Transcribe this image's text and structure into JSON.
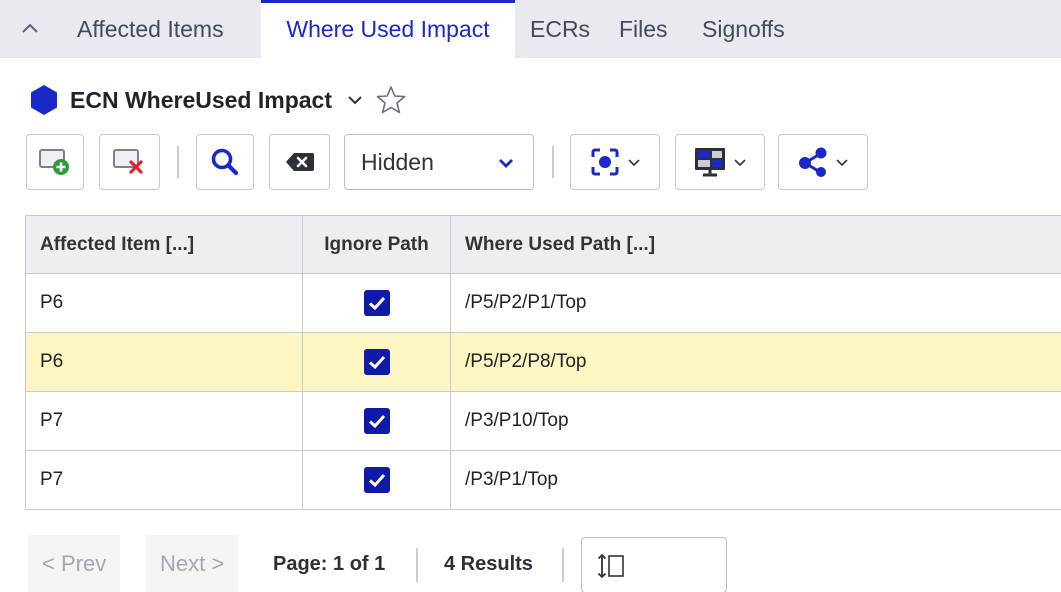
{
  "tabs": [
    {
      "label": "Affected Items",
      "active": false
    },
    {
      "label": "Where Used Impact",
      "active": true
    },
    {
      "label": "ECRs",
      "active": false
    },
    {
      "label": "Files",
      "active": false
    },
    {
      "label": "Signoffs",
      "active": false
    }
  ],
  "header": {
    "title": "ECN WhereUsed Impact",
    "icon": "hexagon-icon",
    "favorite_icon": "star-outline-icon"
  },
  "toolbar": {
    "filter_select": {
      "value": "Hidden"
    },
    "buttons": [
      "add-row-icon",
      "delete-row-icon",
      "search-icon",
      "clear-icon",
      "focus-icon",
      "layout-icon",
      "share-icon"
    ]
  },
  "table": {
    "columns": [
      "Affected Item [...]",
      "Ignore Path",
      "Where Used Path [...]"
    ],
    "rows": [
      {
        "affected_item": "P6",
        "ignore_path": true,
        "where_used_path": "/P5/P2/P1/Top",
        "selected": false
      },
      {
        "affected_item": "P6",
        "ignore_path": true,
        "where_used_path": "/P5/P2/P8/Top",
        "selected": true
      },
      {
        "affected_item": "P7",
        "ignore_path": true,
        "where_used_path": "/P3/P10/Top",
        "selected": false
      },
      {
        "affected_item": "P7",
        "ignore_path": true,
        "where_used_path": "/P3/P1/Top",
        "selected": false
      }
    ]
  },
  "pager": {
    "prev_label": "< Prev",
    "next_label": "Next >",
    "page_info": "Page: 1 of 1",
    "results": "4 Results"
  },
  "colors": {
    "accent": "#1b28c8",
    "selected_row": "#fdf6c3",
    "checkbox": "#0f1aa8",
    "tabbar_bg": "#e8eaef"
  }
}
